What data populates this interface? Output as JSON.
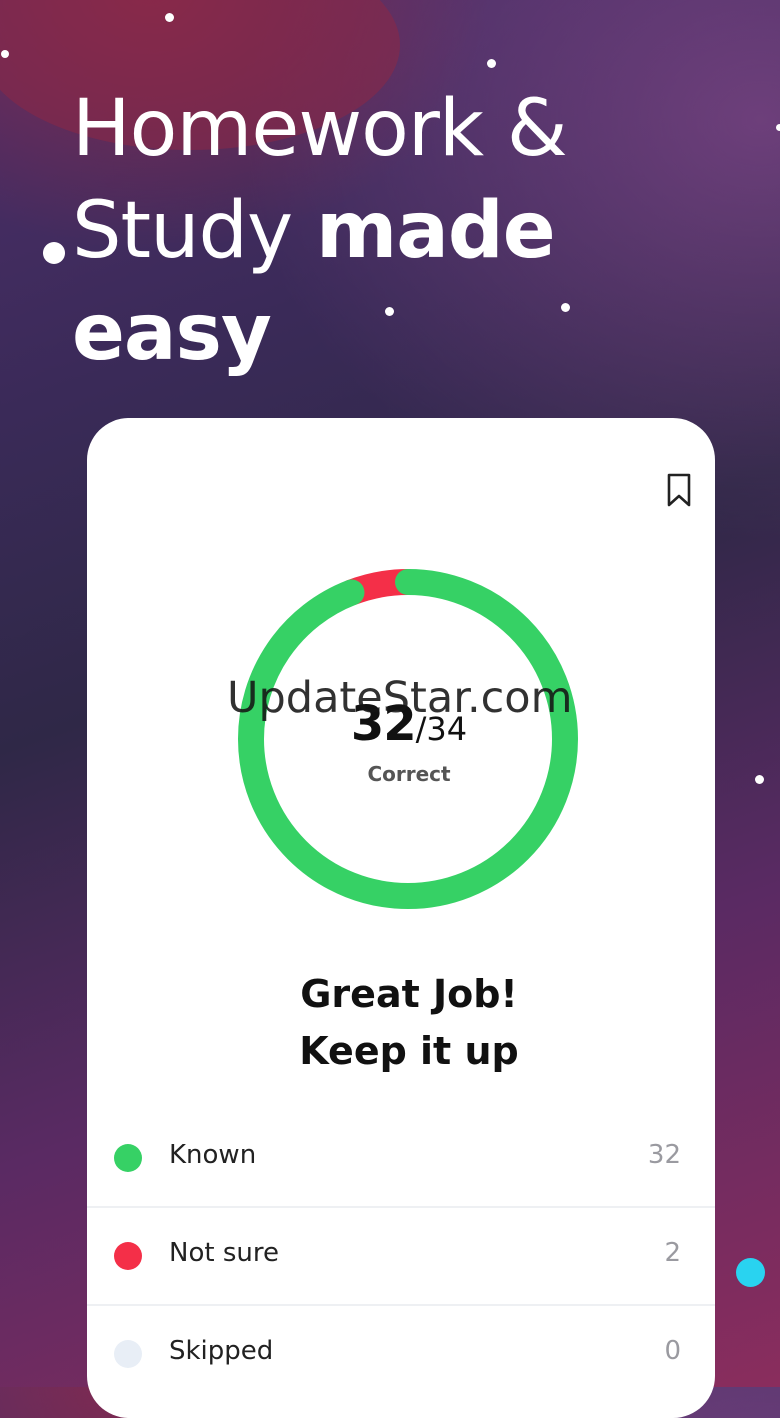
{
  "headline": {
    "line1": "Homework &",
    "line2_light": "Study ",
    "line2_bold": "made",
    "line3_bold": "easy"
  },
  "watermark": "UpdateStar.com",
  "score": {
    "correct": "32",
    "total": "/34",
    "label": "Correct",
    "correct_fraction": 0.941
  },
  "message": {
    "line1": "Great Job!",
    "line2": "Keep it up"
  },
  "legend": [
    {
      "label": "Known",
      "count": "32",
      "color": "#36d165"
    },
    {
      "label": "Not sure",
      "count": "2",
      "color": "#f42f48"
    },
    {
      "label": "Skipped",
      "count": "0",
      "color": "#e8eef6"
    }
  ],
  "colors": {
    "known": "#36d165",
    "not_sure": "#f42f48",
    "accent_dot": "#29d3f0"
  },
  "icons": {
    "bookmark": "bookmark-icon"
  }
}
